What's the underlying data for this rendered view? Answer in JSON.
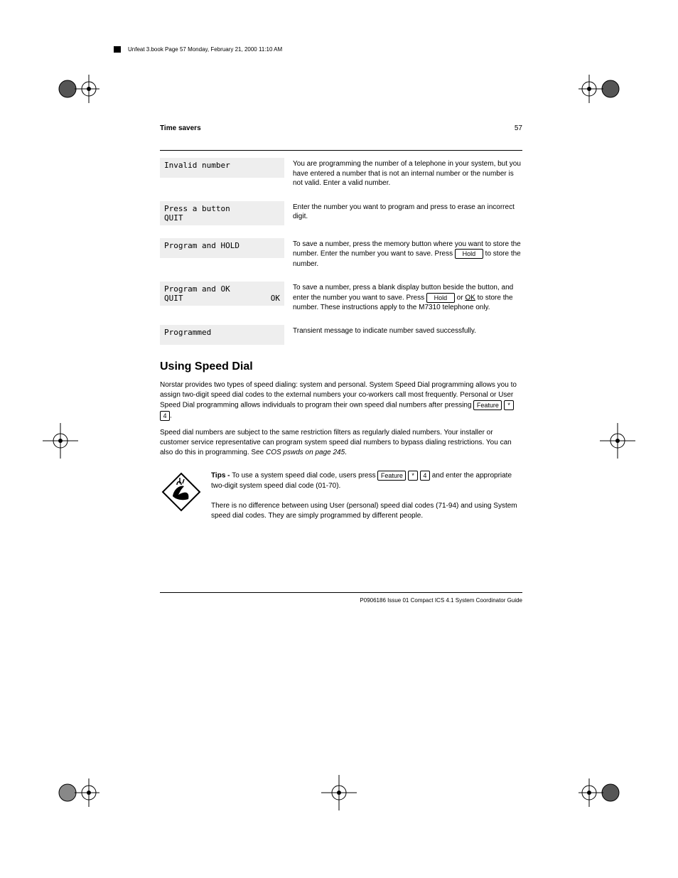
{
  "filebar": "Unfeat 3.book  Page 57  Monday, February 21, 2000  11:10 AM",
  "header": {
    "section": "Time savers",
    "page": "57"
  },
  "displays": {
    "d1": {
      "line1": "Invalid number"
    },
    "d2": {
      "line1": "Press a button",
      "line2_left": "QUIT"
    },
    "d3": {
      "line1": "Program and HOLD"
    },
    "d4": {
      "line1": "Program and OK",
      "line2_left": "QUIT",
      "line2_right": "OK"
    },
    "d5": {
      "line1": "Programmed"
    }
  },
  "descs": {
    "t1": "You are programming the number of a telephone in your system, but you have entered a number that is not an internal number or the number is not valid. Enter a valid number.",
    "t2_a": "Enter the number you want to program and press ",
    "t2_b": " to erase an incorrect digit.",
    "t3_a": "To save a number, press the memory button where you want to store the number. Enter the number you want to save. Press ",
    "t3_b": " to store the number.",
    "t4_a": "To save a number, press a blank display button beside the ",
    "t4_b": " button, and enter the number you want to save. Press ",
    "t4_c": " or ",
    "t4_d": " to store the number. These instructions apply to the M7310 telephone only.",
    "t5": "Transient message to indicate number saved successfully."
  },
  "keys": {
    "hold": "Hold",
    "ok": "OK"
  },
  "speeddial": {
    "heading": "Using Speed Dial",
    "p1_a": "Norstar provides two types of speed dialing: system and personal. System Speed Dial programming allows you to assign two-digit speed dial codes to the external numbers your co-workers call most frequently. Personal or User Speed Dial programming allows individuals to program their own speed dial numbers after pressing ",
    "p1_b": ".",
    "p2_a": "Speed dial numbers are subject to the same restriction filters as regularly dialed numbers. Your installer or customer service representative can program system speed dial numbers to bypass dialing restrictions. You can also do this in programming. See ",
    "p2_link": "COS pswds on page 245",
    "p2_b": "."
  },
  "keypad": {
    "feature": "Feature",
    "star": "*",
    "four": "4"
  },
  "tip": {
    "label": "Tips - ",
    "text_a": "To use a system speed dial code, users press ",
    "text_b": " and enter the appropriate two-digit system speed dial code (01-70).",
    "text_c": "There is no difference between using User (personal) speed dial codes (71-94) and using System speed dial codes. They are simply programmed by different people."
  },
  "footer": "P0906186 Issue 01    Compact ICS 4.1 System Coordinator Guide"
}
